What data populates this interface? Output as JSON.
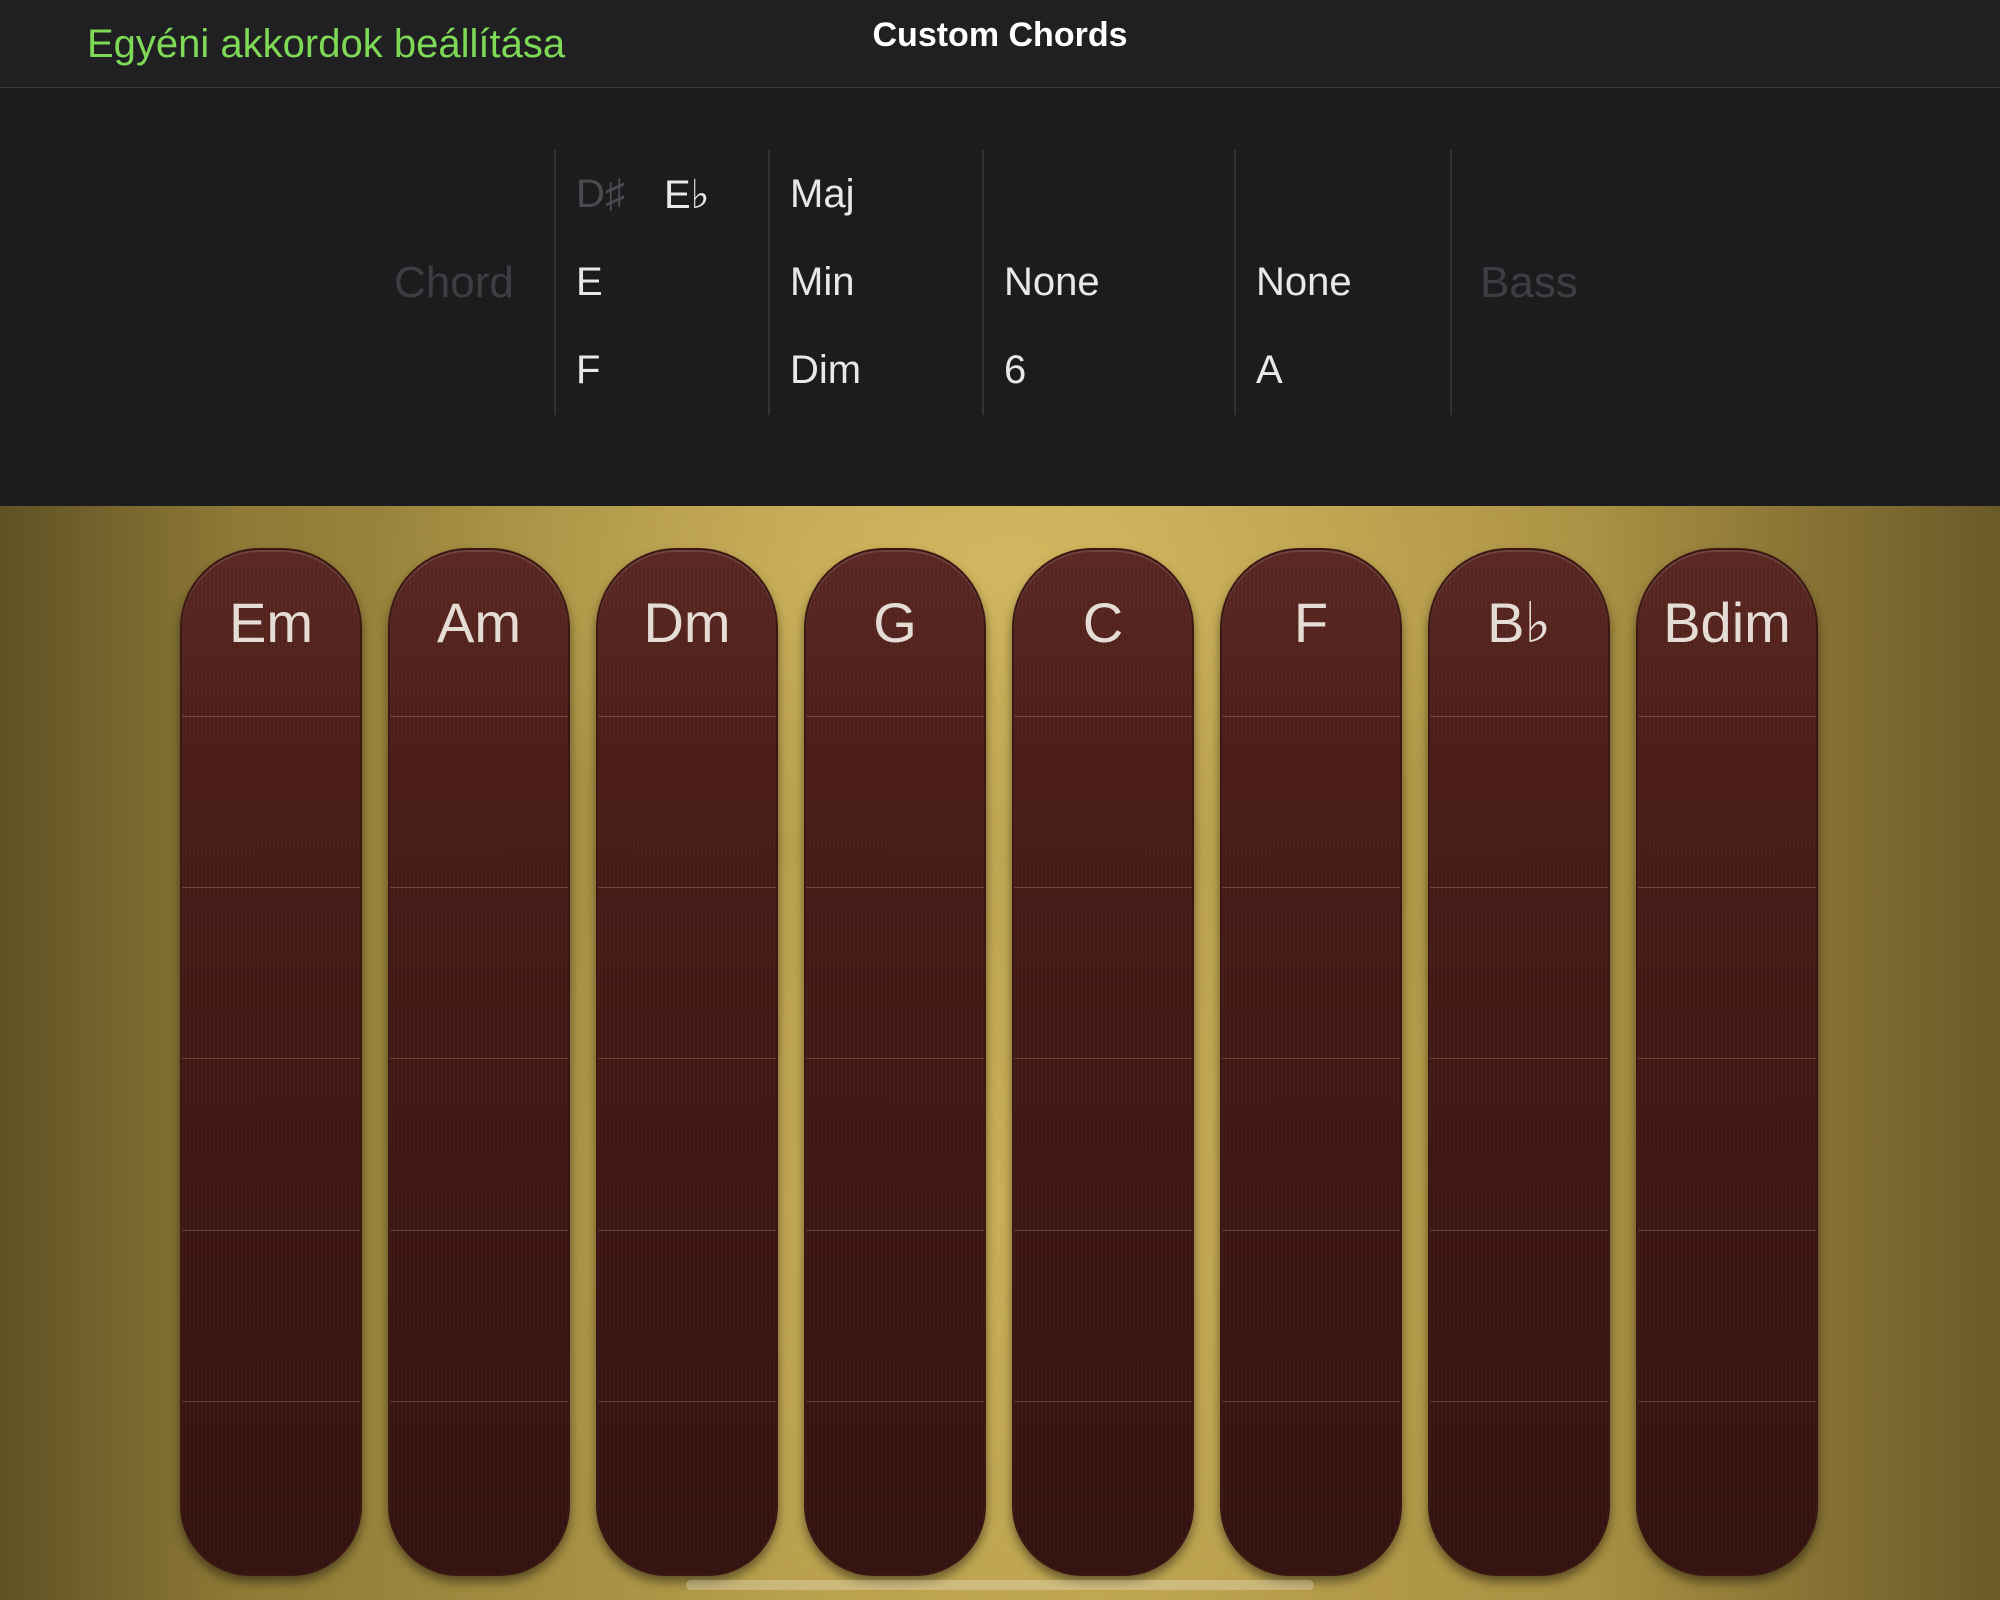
{
  "header": {
    "back_label": "Egyéni akkordok beállítása",
    "title": "Custom Chords"
  },
  "picker": {
    "chord_label": "Chord",
    "bass_label": "Bass",
    "root": {
      "above_sharp": "D♯",
      "above_flat": "E♭",
      "selected": "E",
      "below": "F"
    },
    "quality": {
      "above": "Maj",
      "selected": "Min",
      "below": "Dim"
    },
    "extension": {
      "selected": "None",
      "below": "6"
    },
    "bass_note": {
      "selected": "None",
      "below": "A"
    }
  },
  "chord_strips": [
    {
      "label": "Em"
    },
    {
      "label": "Am"
    },
    {
      "label": "Dm"
    },
    {
      "label": "G"
    },
    {
      "label": "C"
    },
    {
      "label": "F"
    },
    {
      "label": "B♭"
    },
    {
      "label": "Bdim"
    }
  ],
  "colors": {
    "accent": "#7ed957",
    "strip_wood": "#3e1612",
    "panel_bg": "#1c1c1e"
  }
}
